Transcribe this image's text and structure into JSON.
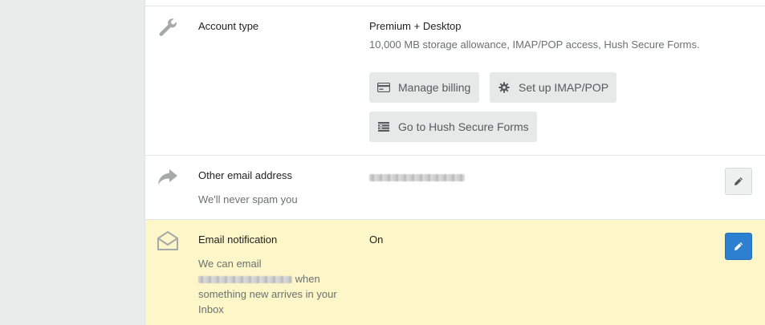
{
  "account": {
    "label": "Account type",
    "value": "Premium + Desktop",
    "description": "10,000 MB storage allowance, IMAP/POP access, Hush Secure Forms.",
    "buttons": {
      "manage_billing": "Manage billing",
      "imap_pop": "Set up IMAP/POP",
      "secure_forms": "Go to Hush Secure Forms"
    },
    "icon": "wrench-icon"
  },
  "other_email": {
    "label": "Other email address",
    "sublabel": "We'll never spam you",
    "icon": "share-arrow-icon"
  },
  "notification": {
    "label": "Email notification",
    "value": "On",
    "sublabel_prefix": "We can email",
    "sublabel_suffix": "when something new arrives in your Inbox",
    "icon": "envelope-open-icon"
  },
  "colors": {
    "accent": "#2d7fcf",
    "highlight_row": "#fdf6c8",
    "sidebar": "#e8edeb"
  }
}
